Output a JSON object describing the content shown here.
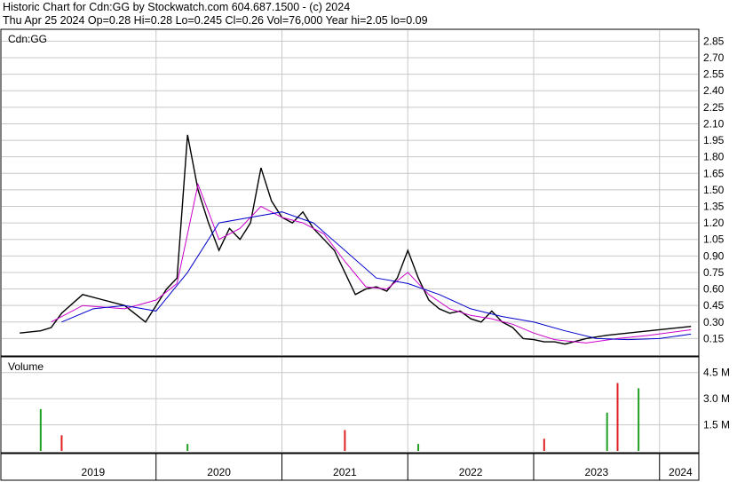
{
  "header": {
    "line1": "Historic Chart for Cdn:GG by Stockwatch.com 604.687.1500 - (c) 2024",
    "line2": "Thu Apr 25 2024  Op=0.28  Hi=0.28  Lo=0.245  Cl=0.26  Vol=76,000  Year hi=2.05  lo=0.09"
  },
  "chart_data": [
    {
      "type": "line",
      "title": "Cdn:GG",
      "symbol_label": "Cdn:GG",
      "xlabel": "",
      "ylabel": "",
      "x_ticks": [
        "2019",
        "2020",
        "2021",
        "2022",
        "2023",
        "2024"
      ],
      "y_ticks": [
        "0.15",
        "0.30",
        "0.45",
        "0.60",
        "0.75",
        "0.90",
        "1.05",
        "1.20",
        "1.35",
        "1.50",
        "1.65",
        "1.80",
        "1.95",
        "2.10",
        "2.25",
        "2.40",
        "2.55",
        "2.70",
        "2.85"
      ],
      "ylim": [
        0.0,
        2.95
      ],
      "grid": true,
      "colors": {
        "price": "#000000",
        "ma_short": "#cc00cc",
        "ma_long": "#0000cc"
      },
      "series": [
        {
          "role": "price",
          "x": [
            "2018-12",
            "2019-02",
            "2019-03",
            "2019-04",
            "2019-06",
            "2019-08",
            "2019-10",
            "2019-12",
            "2020-01",
            "2020-02",
            "2020-03",
            "2020-04",
            "2020-05",
            "2020-06",
            "2020-07",
            "2020-08",
            "2020-09",
            "2020-10",
            "2020-11",
            "2020-12",
            "2021-01",
            "2021-02",
            "2021-03",
            "2021-04",
            "2021-05",
            "2021-06",
            "2021-07",
            "2021-08",
            "2021-09",
            "2021-10",
            "2021-11",
            "2021-12",
            "2022-01",
            "2022-02",
            "2022-03",
            "2022-04",
            "2022-05",
            "2022-06",
            "2022-07",
            "2022-08",
            "2022-09",
            "2022-10",
            "2022-11",
            "2022-12",
            "2023-01",
            "2023-02",
            "2023-03",
            "2023-04",
            "2023-06",
            "2023-08",
            "2023-10",
            "2023-12",
            "2024-02",
            "2024-04"
          ],
          "y": [
            0.2,
            0.22,
            0.25,
            0.38,
            0.55,
            0.5,
            0.45,
            0.3,
            0.45,
            0.6,
            0.7,
            2.0,
            1.5,
            1.2,
            0.95,
            1.15,
            1.05,
            1.2,
            1.7,
            1.4,
            1.25,
            1.2,
            1.3,
            1.15,
            1.05,
            0.95,
            0.75,
            0.55,
            0.6,
            0.62,
            0.58,
            0.7,
            0.95,
            0.7,
            0.5,
            0.42,
            0.38,
            0.4,
            0.33,
            0.3,
            0.4,
            0.3,
            0.25,
            0.15,
            0.14,
            0.12,
            0.12,
            0.1,
            0.15,
            0.18,
            0.2,
            0.22,
            0.24,
            0.26
          ]
        },
        {
          "role": "ma_short",
          "x": [
            "2019-03",
            "2019-06",
            "2019-10",
            "2020-01",
            "2020-03",
            "2020-05",
            "2020-07",
            "2020-09",
            "2020-11",
            "2021-01",
            "2021-03",
            "2021-05",
            "2021-07",
            "2021-09",
            "2021-11",
            "2022-01",
            "2022-03",
            "2022-05",
            "2022-07",
            "2022-09",
            "2022-11",
            "2023-01",
            "2023-03",
            "2023-06",
            "2023-09",
            "2023-12",
            "2024-04"
          ],
          "y": [
            0.3,
            0.45,
            0.42,
            0.5,
            0.65,
            1.55,
            1.05,
            1.15,
            1.35,
            1.25,
            1.2,
            1.1,
            0.85,
            0.62,
            0.6,
            0.75,
            0.55,
            0.42,
            0.36,
            0.33,
            0.28,
            0.2,
            0.14,
            0.11,
            0.15,
            0.18,
            0.23
          ]
        },
        {
          "role": "ma_long",
          "x": [
            "2019-04",
            "2019-07",
            "2019-10",
            "2020-01",
            "2020-04",
            "2020-07",
            "2020-10",
            "2021-01",
            "2021-04",
            "2021-07",
            "2021-10",
            "2022-01",
            "2022-04",
            "2022-07",
            "2022-10",
            "2023-01",
            "2023-04",
            "2023-07",
            "2023-10",
            "2024-01",
            "2024-04"
          ],
          "y": [
            0.3,
            0.42,
            0.45,
            0.4,
            0.75,
            1.2,
            1.25,
            1.3,
            1.2,
            0.95,
            0.7,
            0.65,
            0.55,
            0.42,
            0.35,
            0.3,
            0.22,
            0.15,
            0.14,
            0.15,
            0.19
          ]
        }
      ]
    },
    {
      "type": "bar",
      "title": "Volume",
      "y_ticks": [
        "1.5 M",
        "3.0 M",
        "4.5 M"
      ],
      "ylim": [
        0,
        5.3
      ],
      "grid": true,
      "unit": "M",
      "x": [
        "2019-02",
        "2019-04",
        "2020-04",
        "2021-07",
        "2022-02",
        "2023-02",
        "2023-08",
        "2023-09",
        "2023-11"
      ],
      "values": [
        2.4,
        0.9,
        0.4,
        1.2,
        0.4,
        0.7,
        2.2,
        3.9,
        3.6
      ]
    }
  ]
}
